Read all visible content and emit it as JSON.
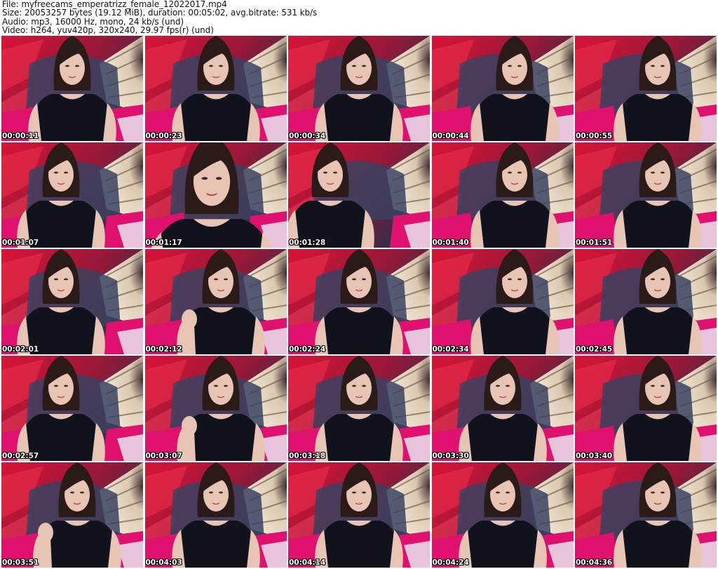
{
  "header": {
    "file_line": "File: myfreecams_emperatrizz_female_12022017.mp4",
    "size_line": "Size: 20053257 bytes (19.12 MiB), duration: 00:05:02, avg.bitrate: 531 kb/s",
    "audio_line": "Audio: mp3, 16000 Hz, mono, 24 kb/s (und)",
    "video_line": "Video: h264, yuv420p, 320x240, 29.97 fps(r) (und)"
  },
  "colors": {
    "background_red": "#d81438",
    "pink_pillow": "#e0106e",
    "dark_shirt": "#10121c",
    "skin": "#e8c4b4",
    "hair": "#2a1a18",
    "fan": "#d8c8b0",
    "cushion_blue": "#3a4260",
    "white_fabric": "#e8e4ee"
  },
  "thumbnails": [
    {
      "time": "00:00:11",
      "pose": "center"
    },
    {
      "time": "00:00:23",
      "pose": "center"
    },
    {
      "time": "00:00:34",
      "pose": "center"
    },
    {
      "time": "00:00:44",
      "pose": "right"
    },
    {
      "time": "00:00:55",
      "pose": "right"
    },
    {
      "time": "00:01:07",
      "pose": "left"
    },
    {
      "time": "00:01:17",
      "pose": "close"
    },
    {
      "time": "00:01:28",
      "pose": "lean"
    },
    {
      "time": "00:01:40",
      "pose": "right"
    },
    {
      "time": "00:01:51",
      "pose": "right"
    },
    {
      "time": "00:02:01",
      "pose": "left"
    },
    {
      "time": "00:02:12",
      "pose": "hand"
    },
    {
      "time": "00:02:24",
      "pose": "center"
    },
    {
      "time": "00:02:34",
      "pose": "right"
    },
    {
      "time": "00:02:45",
      "pose": "right"
    },
    {
      "time": "00:02:57",
      "pose": "left"
    },
    {
      "time": "00:03:07",
      "pose": "hand"
    },
    {
      "time": "00:03:18",
      "pose": "center"
    },
    {
      "time": "00:03:30",
      "pose": "center"
    },
    {
      "time": "00:03:40",
      "pose": "right"
    },
    {
      "time": "00:03:51",
      "pose": "hand"
    },
    {
      "time": "00:04:03",
      "pose": "center"
    },
    {
      "time": "00:04:14",
      "pose": "center"
    },
    {
      "time": "00:04:24",
      "pose": "center"
    },
    {
      "time": "00:04:36",
      "pose": "right"
    }
  ]
}
